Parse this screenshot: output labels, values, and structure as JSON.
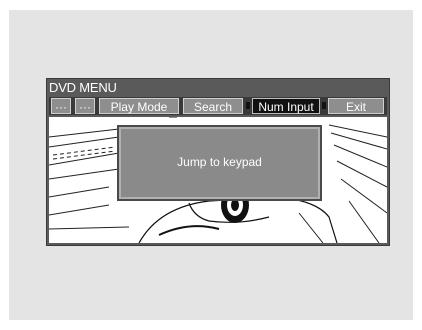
{
  "menu": {
    "title": "DVD MENU",
    "buttons": [
      {
        "label": "···"
      },
      {
        "label": "···"
      },
      {
        "label": "Play Mode"
      },
      {
        "label": "Search"
      },
      {
        "label": "Num Input",
        "selected": true
      },
      {
        "label": "Exit"
      }
    ]
  },
  "dialog": {
    "message": "Jump to  keypad"
  },
  "colors": {
    "menubar": "#3a3a3a",
    "button": "#8e8e8e",
    "selected_button": "#111111",
    "dialog": "#8a8a8a"
  }
}
